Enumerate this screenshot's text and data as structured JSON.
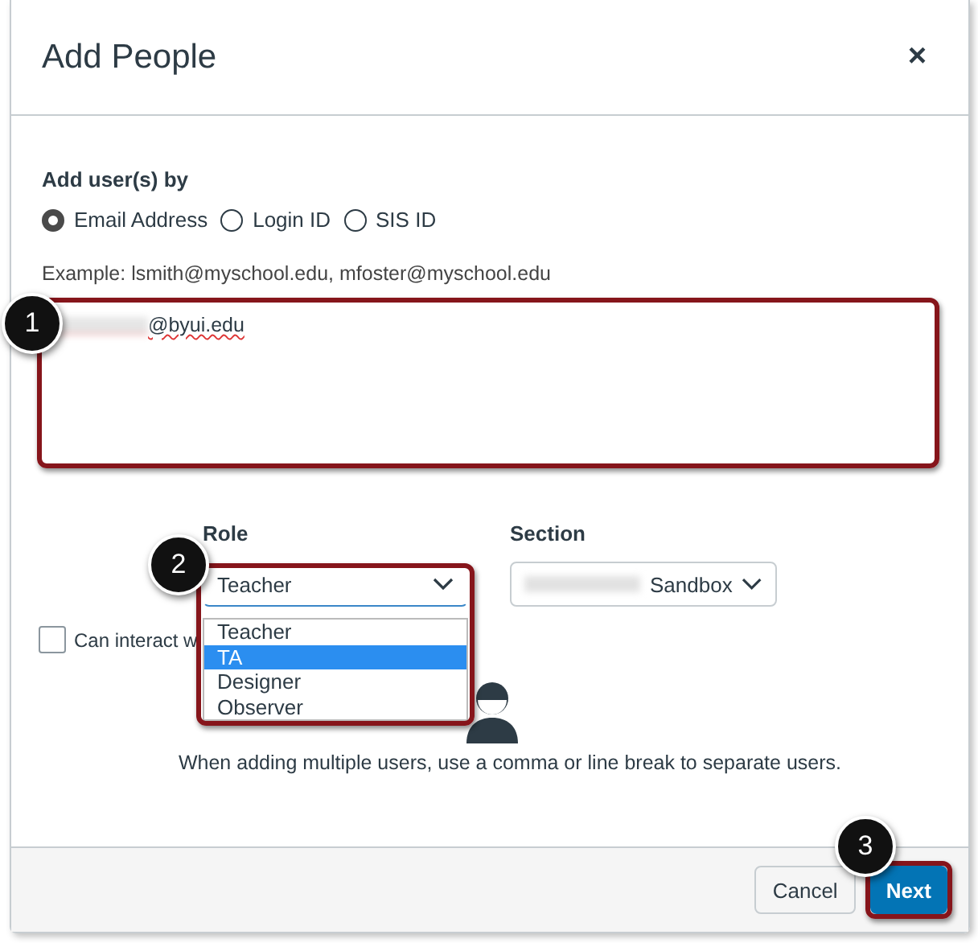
{
  "dialog": {
    "title": "Add People",
    "close": "×"
  },
  "add_by": {
    "label": "Add user(s) by",
    "options": [
      {
        "label": "Email Address",
        "selected": true
      },
      {
        "label": "Login ID",
        "selected": false
      },
      {
        "label": "SIS ID",
        "selected": false
      }
    ]
  },
  "example": "Example: lsmith@myschool.edu, mfoster@myschool.edu",
  "users_field": {
    "value": "@byui.edu"
  },
  "role": {
    "label": "Role",
    "value": "Teacher",
    "expanded": true,
    "options": [
      {
        "label": "Teacher",
        "highlighted": false
      },
      {
        "label": "TA",
        "highlighted": true
      },
      {
        "label": "Designer",
        "highlighted": false
      },
      {
        "label": "Observer",
        "highlighted": false
      }
    ]
  },
  "section": {
    "label": "Section",
    "value": "Sandbox"
  },
  "interact_checkbox": {
    "label": "Can interact w",
    "checked": false
  },
  "help_text": "When adding multiple users, use a comma or line break to separate users.",
  "buttons": [
    {
      "label": "Cancel",
      "kind": "secondary"
    },
    {
      "label": "Next",
      "kind": "primary"
    }
  ],
  "callouts": [
    "1",
    "2",
    "3"
  ]
}
